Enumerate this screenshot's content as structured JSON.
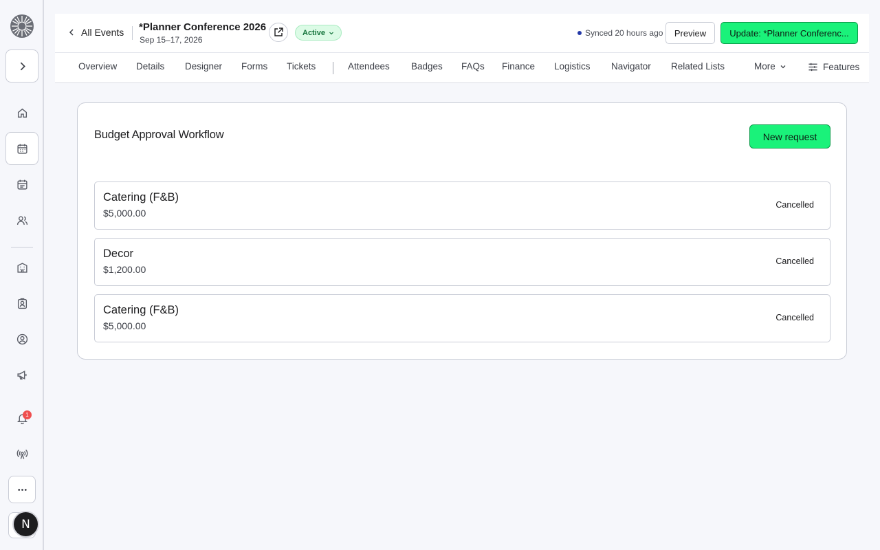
{
  "header": {
    "back_label": "All Events",
    "event_title": "*Planner Conference 2026",
    "event_dates": "Sep 15–17, 2026",
    "status": "Active",
    "sync_text": "Synced 20 hours ago",
    "preview_label": "Preview",
    "update_label": "Update: *Planner Conferenc..."
  },
  "tabs": [
    {
      "label": "Overview"
    },
    {
      "label": "Details"
    },
    {
      "label": "Designer"
    },
    {
      "label": "Forms"
    },
    {
      "label": "Tickets"
    },
    {
      "label": "Attendees"
    },
    {
      "label": "Badges"
    },
    {
      "label": "FAQs"
    },
    {
      "label": "Finance"
    },
    {
      "label": "Logistics"
    },
    {
      "label": "Navigator"
    },
    {
      "label": "Related Lists"
    }
  ],
  "more_label": "More",
  "features_label": "Features",
  "sidebar": {
    "notification_count": "1",
    "avatar_initial": "N",
    "icons": [
      "logo-icon",
      "expand-icon",
      "home-icon",
      "calendar-icon",
      "schedule-icon",
      "people-icon",
      "building-icon",
      "badge-icon",
      "user-circle-icon",
      "megaphone-icon",
      "bell-icon",
      "broadcast-icon",
      "more-icon"
    ]
  },
  "workflow": {
    "title": "Budget Approval Workflow",
    "new_request_label": "New request",
    "requests": [
      {
        "name": "Catering (F&B)",
        "amount": "$5,000.00",
        "status": "Cancelled"
      },
      {
        "name": "Decor",
        "amount": "$1,200.00",
        "status": "Cancelled"
      },
      {
        "name": "Catering (F&B)",
        "amount": "$5,000.00",
        "status": "Cancelled"
      }
    ]
  },
  "colors": {
    "accent_green": "#1af27a",
    "active_pill_bg": "#dcfbe6",
    "sync_dot": "#2439a8",
    "badge_red": "#ef4f4f"
  }
}
